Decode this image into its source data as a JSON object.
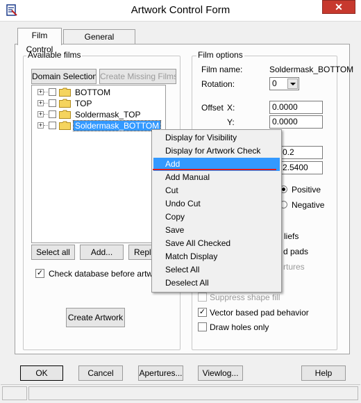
{
  "window": {
    "title": "Artwork Control Form",
    "close_label": "✕"
  },
  "tabs": [
    {
      "label": "Film Control"
    },
    {
      "label": "General Parameters"
    }
  ],
  "available_films": {
    "legend": "Available films",
    "domain_selection": "Domain Selection",
    "create_missing": "Create Missing Films",
    "films": [
      {
        "name": "BOTTOM"
      },
      {
        "name": "TOP"
      },
      {
        "name": "Soldermask_TOP"
      },
      {
        "name": "Soldermask_BOTTOM"
      }
    ],
    "select_all": "Select all",
    "add": "Add...",
    "replace": "Repl",
    "check_db_label": "Check database before artwork",
    "check_db_checked": "✓",
    "create_artwork": "Create Artwork"
  },
  "film_options": {
    "legend": "Film options",
    "film_name_label": "Film name:",
    "film_name_value": "Soldermask_BOTTOM",
    "rotation_label": "Rotation:",
    "rotation_value": "0",
    "offset_label": "Offset",
    "x_label": "X:",
    "x_value": "0.0000",
    "y_label": "Y:",
    "y_value": "0.0000",
    "field3_value": "0.2",
    "field4_value": "2.5400",
    "positive_label": "Positive",
    "negative_label": "Negative",
    "reliefs_tail": "liefs",
    "pads_tail": "d pads",
    "apertures_tail": "rtures",
    "suppress_shape_fill": "Suppress shape fill",
    "vector_pad": "Vector based pad behavior",
    "vector_pad_checked": "✓",
    "draw_holes_only": "Draw holes only"
  },
  "context_menu": {
    "items": [
      {
        "label": "Display for Visibility"
      },
      {
        "label": "Display for Artwork Check"
      },
      {
        "label": "Add"
      },
      {
        "label": "Add Manual"
      },
      {
        "label": "Cut"
      },
      {
        "label": "Undo Cut"
      },
      {
        "label": "Copy"
      },
      {
        "label": "Save"
      },
      {
        "label": "Save All Checked"
      },
      {
        "label": "Match Display"
      },
      {
        "label": "Select All"
      },
      {
        "label": "Deselect All"
      }
    ],
    "highlight_color": "#3399ff",
    "underline_color": "#e01b1b"
  },
  "footer": {
    "ok": "OK",
    "cancel": "Cancel",
    "apertures": "Apertures...",
    "viewlog": "Viewlog...",
    "help": "Help"
  }
}
